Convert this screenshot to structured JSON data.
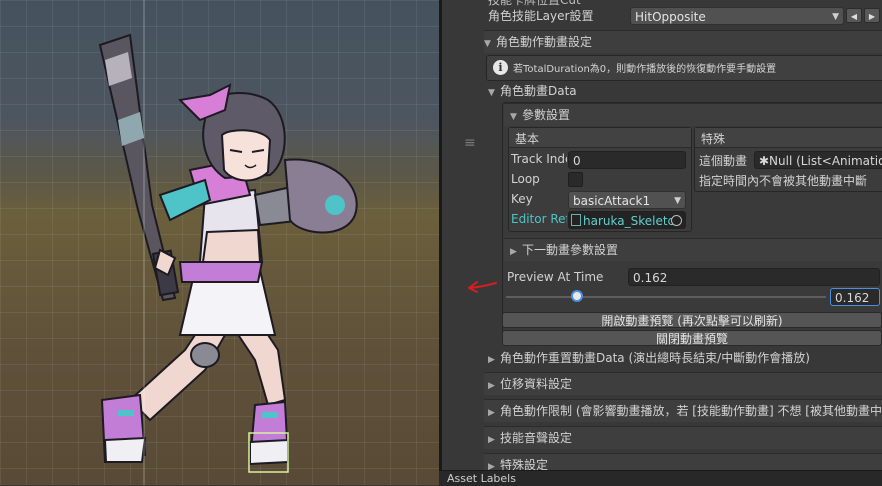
{
  "inspector": {
    "cut_top_label": "技能卡牌位置Cut",
    "layer_label": "角色技能Layer設置",
    "layer_value": "HitOpposite",
    "anim_setting_label": "角色動作動畫設定",
    "info_text": "若TotalDuration為0，則動作播放後的恢復動作要手動設置",
    "anim_data_label": "角色動畫Data",
    "param_label": "參數設置",
    "basic_header": "基本",
    "special_header": "特殊",
    "track_index_label": "Track Inde",
    "track_index_value": "0",
    "loop_label": "Loop",
    "key_label": "Key",
    "key_value": "basicAttack1",
    "editor_ref_label": "Editor Ref",
    "editor_ref_value": "haruka_Skeletc",
    "special_field_label": "這個動畫",
    "special_field_value": "✱Null (List<Animation",
    "special_note": "指定時間內不會被其他動畫中斷",
    "next_anim_label": "下一動畫參數設置",
    "preview_label": "Preview At Time",
    "preview_value": "0.162",
    "slider_value": "0.162",
    "slider_fraction": 0.21,
    "open_preview_button": "開啟動畫預覽 (再次點擊可以刷新)",
    "close_preview_button": "關閉動畫預覽",
    "reset_anim_label": "角色動作重置動畫Data (演出總時長結束/中斷動作會播放)",
    "displacement_label": "位移資料設定",
    "restriction_label": "角色動作限制 (會影響動畫播放，若 [技能動作動畫] 不想 [被其他動畫中",
    "sound_label": "技能音聲設定",
    "special_setting_label": "特殊設定"
  },
  "footer": {
    "label": "Asset Labels"
  },
  "icons": {
    "info": "info-icon",
    "fold_open": "triangle-down-icon",
    "fold_closed": "triangle-right-icon",
    "arrow_left": "arrow-left-icon",
    "arrow_right": "arrow-right-icon",
    "target": "target-icon",
    "asset": "skeleton-asset-icon",
    "grip": "drag-handle-icon",
    "annotation": "red-arrow-annotation"
  },
  "colors": {
    "accent_blue": "#4d8fe0",
    "link_cyan": "#4ec4c8",
    "annotation_red": "#d42020",
    "panel_bg": "#383838"
  }
}
